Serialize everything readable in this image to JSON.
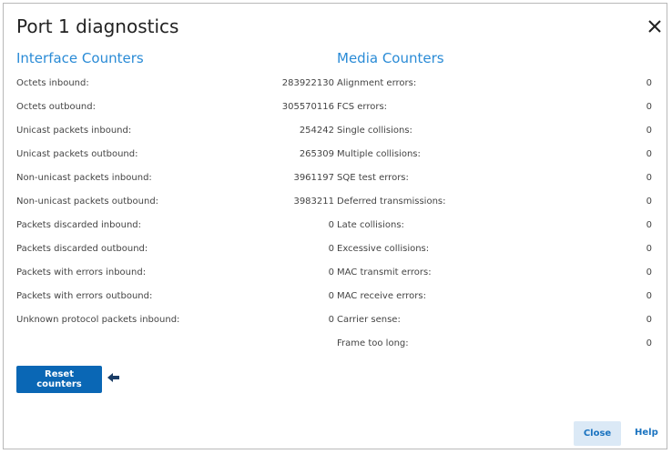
{
  "dialog": {
    "title": "Port 1 diagnostics",
    "close_icon": "close-icon"
  },
  "interface_counters": {
    "heading": "Interface Counters",
    "rows": [
      {
        "label": "Octets inbound:",
        "value": "283922130"
      },
      {
        "label": "Octets outbound:",
        "value": "305570116"
      },
      {
        "label": "Unicast packets inbound:",
        "value": "254242"
      },
      {
        "label": "Unicast packets outbound:",
        "value": "265309"
      },
      {
        "label": "Non-unicast packets inbound:",
        "value": "3961197"
      },
      {
        "label": "Non-unicast packets outbound:",
        "value": "3983211"
      },
      {
        "label": "Packets discarded inbound:",
        "value": "0"
      },
      {
        "label": "Packets discarded outbound:",
        "value": "0"
      },
      {
        "label": "Packets with errors inbound:",
        "value": "0"
      },
      {
        "label": "Packets with errors outbound:",
        "value": "0"
      },
      {
        "label": "Unknown protocol packets inbound:",
        "value": "0"
      }
    ]
  },
  "media_counters": {
    "heading": "Media Counters",
    "rows": [
      {
        "label": "Alignment errors:",
        "value": "0"
      },
      {
        "label": "FCS errors:",
        "value": "0"
      },
      {
        "label": "Single collisions:",
        "value": "0"
      },
      {
        "label": "Multiple collisions:",
        "value": "0"
      },
      {
        "label": "SQE test errors:",
        "value": "0"
      },
      {
        "label": "Deferred transmissions:",
        "value": "0"
      },
      {
        "label": "Late collisions:",
        "value": "0"
      },
      {
        "label": "Excessive collisions:",
        "value": "0"
      },
      {
        "label": "MAC transmit errors:",
        "value": "0"
      },
      {
        "label": "MAC receive errors:",
        "value": "0"
      },
      {
        "label": "Carrier sense:",
        "value": "0"
      },
      {
        "label": "Frame too long:",
        "value": "0"
      }
    ]
  },
  "actions": {
    "reset_label": "Reset counters",
    "close_label": "Close",
    "help_label": "Help"
  },
  "colors": {
    "accent": "#2a8bd6",
    "primary_button": "#0a67b5",
    "secondary_button": "#dbe9f6"
  }
}
